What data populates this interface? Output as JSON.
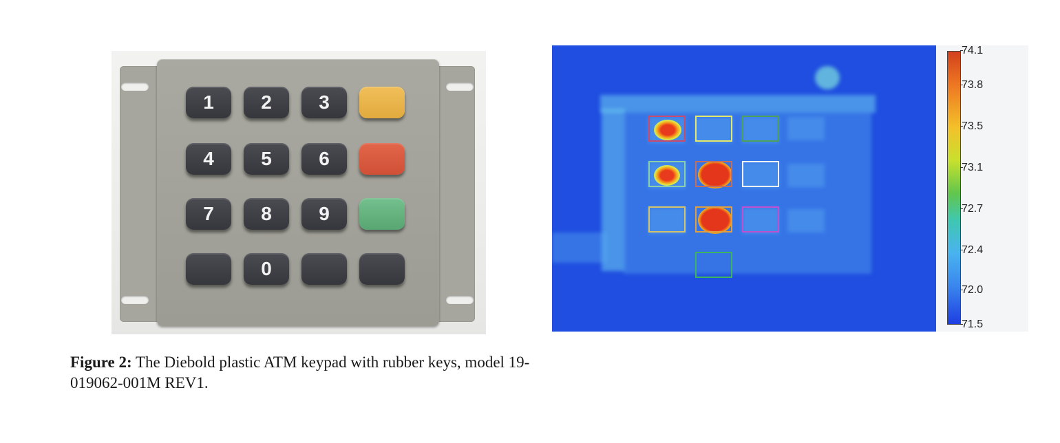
{
  "figure": {
    "caption_label": "Figure 2:",
    "caption_text": "The Diebold plastic ATM keypad with rubber keys, model 19-019062-001M REV1."
  },
  "keypad": {
    "rows": [
      [
        {
          "label": "1",
          "color": "dark"
        },
        {
          "label": "2",
          "color": "dark"
        },
        {
          "label": "3",
          "color": "dark"
        },
        {
          "label": "",
          "color": "yellow"
        }
      ],
      [
        {
          "label": "4",
          "color": "dark"
        },
        {
          "label": "5",
          "color": "dark"
        },
        {
          "label": "6",
          "color": "dark"
        },
        {
          "label": "",
          "color": "red"
        }
      ],
      [
        {
          "label": "7",
          "color": "dark"
        },
        {
          "label": "8",
          "color": "dark"
        },
        {
          "label": "9",
          "color": "dark"
        },
        {
          "label": "",
          "color": "green"
        }
      ],
      [
        {
          "label": "",
          "color": "dark"
        },
        {
          "label": "0",
          "color": "dark"
        },
        {
          "label": "",
          "color": "dark"
        },
        {
          "label": "",
          "color": "dark"
        }
      ]
    ]
  },
  "thermal": {
    "colorbar": {
      "ticks": [
        "74.1",
        "73.8",
        "73.5",
        "73.1",
        "72.7",
        "72.4",
        "72.0",
        "71.5"
      ],
      "colors": [
        "#d2411d",
        "#ee7622",
        "#f3c12a",
        "#c8e02e",
        "#62c64c",
        "#3fc7b1",
        "#49b3ef",
        "#3a86ee",
        "#1e3ee2"
      ]
    },
    "background_color": "#1f4ee0",
    "roi_colors": [
      "#c94a6c",
      "#e6e86a",
      "#4fa05a",
      "#8bd0a8",
      "#c07060",
      "#f2f2f2",
      "#d6c46a",
      "#e0a040",
      "#c050d0",
      "#3fb460"
    ]
  }
}
